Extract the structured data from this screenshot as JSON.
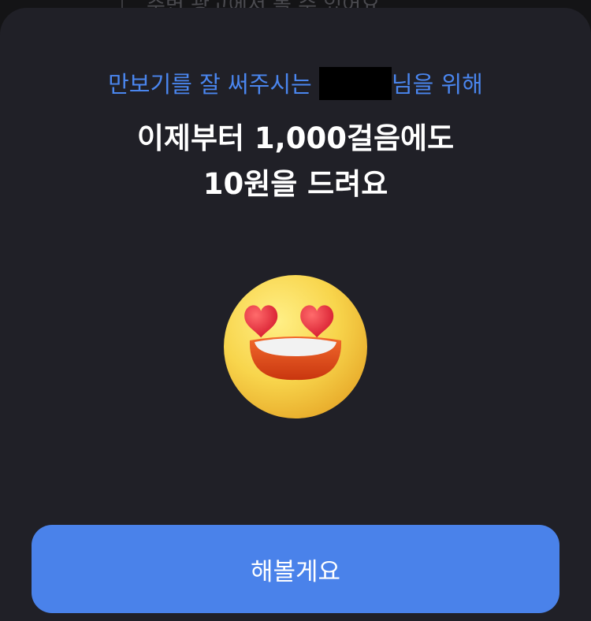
{
  "background": {
    "obscured_text": "주변 광고에서 볼 수 있어요"
  },
  "dialog": {
    "subtitle_prefix": "만보기를 잘 써주시는 ",
    "subtitle_suffix": "님을 위해",
    "headline_line1": "이제부터 1,000걸음에도",
    "headline_line2": "10원을 드려요",
    "emoji_icon": "heart-eyes-smiling-face",
    "confirm_label": "해볼게요"
  },
  "colors": {
    "sheet": "#202027",
    "accent_text": "#4a86ef",
    "button": "#4a82ea",
    "headline": "#ffffff"
  }
}
